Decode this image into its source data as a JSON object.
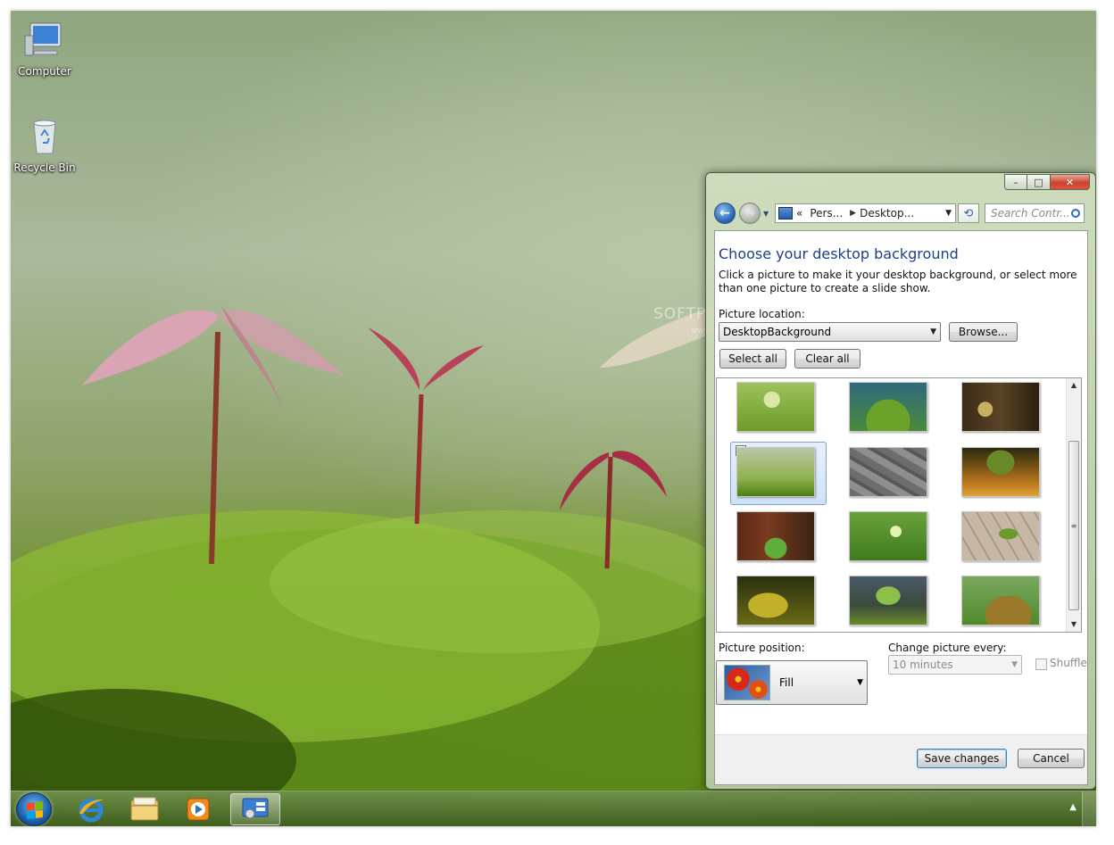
{
  "desktop": {
    "icons": [
      {
        "label": "Computer"
      },
      {
        "label": "Recycle Bin"
      }
    ],
    "watermark": "SOFTPEDIA",
    "watermark_url": "www.softpedia.com"
  },
  "window": {
    "caption_buttons": {
      "minimize": "–",
      "maximize": "□",
      "close": "✕"
    },
    "nav": {
      "back_glyph": "←",
      "forward_glyph": "→",
      "address_segments": [
        "Pers...",
        "Desktop..."
      ],
      "address_prefix": "«",
      "search_placeholder": "Search Contr..."
    },
    "heading": "Choose your desktop background",
    "description": "Click a picture to make it your desktop background, or select more than one picture to create a slide show.",
    "picture_location_label": "Picture location:",
    "picture_location_value": "DesktopBackground",
    "browse_label": "Browse...",
    "select_all_label": "Select all",
    "clear_all_label": "Clear all",
    "thumbnails": [
      {
        "name": "sprout",
        "selected": false
      },
      {
        "name": "moss-stream",
        "selected": false
      },
      {
        "name": "forest-sapling",
        "selected": false
      },
      {
        "name": "red-sprouts",
        "selected": true
      },
      {
        "name": "stone-wall",
        "selected": false
      },
      {
        "name": "sunlit-sprout",
        "selected": false
      },
      {
        "name": "redwood-fern",
        "selected": false
      },
      {
        "name": "green-bokeh",
        "selected": false
      },
      {
        "name": "dry-earth",
        "selected": false
      },
      {
        "name": "moss-log",
        "selected": false
      },
      {
        "name": "leaf-sprout",
        "selected": false
      },
      {
        "name": "hill-sprout",
        "selected": false
      }
    ],
    "picture_position_label": "Picture position:",
    "picture_position_value": "Fill",
    "change_every_label": "Change picture every:",
    "change_every_value": "10 minutes",
    "shuffle_label": "Shuffle",
    "save_label": "Save changes",
    "cancel_label": "Cancel"
  },
  "taskbar": {
    "tray_arrow": "▲"
  },
  "colors": {
    "heading": "#1e3f87",
    "accent": "#2b6bbf"
  }
}
